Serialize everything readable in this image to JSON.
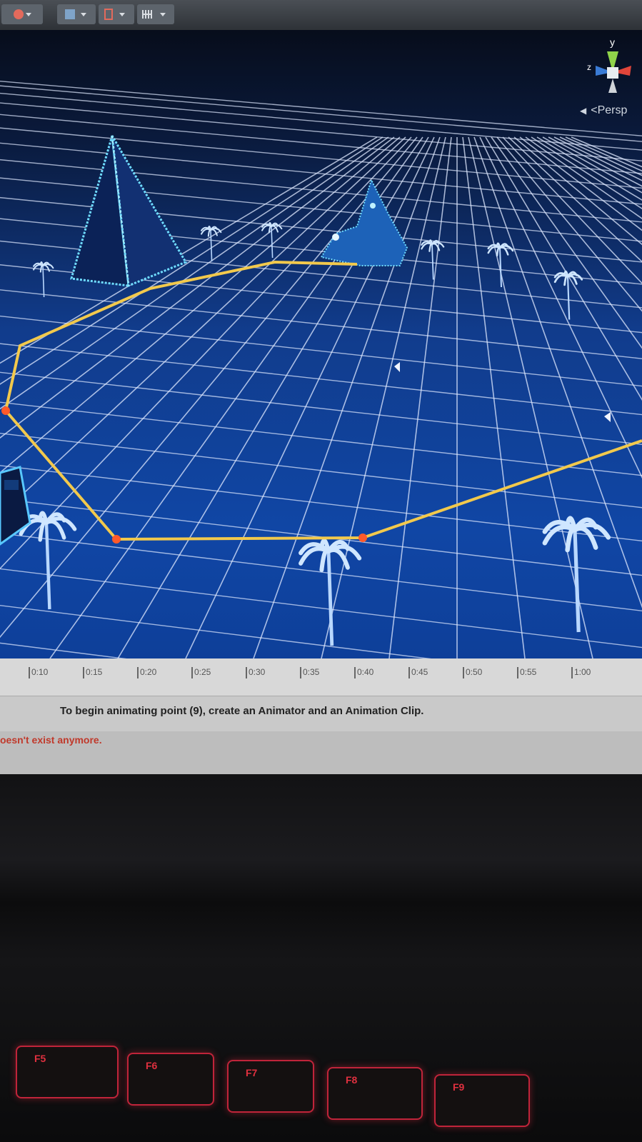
{
  "toolbar": {
    "buttons": [
      {
        "icon": "globe-icon"
      },
      {
        "icon": "gizmo-icon"
      },
      {
        "icon": "render-mode-icon"
      },
      {
        "icon": "audio-icon"
      }
    ]
  },
  "viewport": {
    "projection_label": "<Persp",
    "axis_label_y": "y",
    "axis_label_z": "z",
    "axis_colors": {
      "x": "#e0453a",
      "y": "#8fd34a",
      "z": "#3a7bd5"
    }
  },
  "timeline": {
    "ticks": [
      "0:10",
      "0:15",
      "0:20",
      "0:25",
      "0:30",
      "0:35",
      "0:40",
      "0:45",
      "0:50",
      "0:55",
      "1:00"
    ]
  },
  "status": {
    "message": "To begin animating point (9), create an Animator and an Animation Clip.",
    "error": "oesn't exist anymore."
  },
  "keyboard": {
    "keys": [
      "F5",
      "F6",
      "F7",
      "F8",
      "F9"
    ]
  },
  "colors": {
    "path_line": "#f2c94c",
    "path_node": "#ff5a2a",
    "grid": "#dfe9ff",
    "neon": "#56d0ff",
    "error": "#c0392b"
  }
}
